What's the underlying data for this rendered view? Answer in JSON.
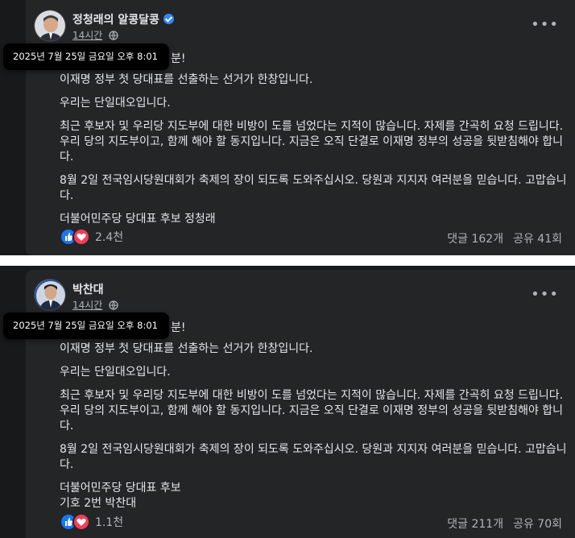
{
  "posts": [
    {
      "author": "정청래의 알콩달콩",
      "verified": true,
      "time": "14시간",
      "tooltip": "2025년 7월 25일 금요일 오후 8:01",
      "first_line_trail": "분!",
      "paragraphs": [
        "이재명 정부 첫 당대표를 선출하는 선거가 한창입니다.",
        "우리는 단일대오입니다.",
        "최근 후보자 및 우리당 지도부에 대한 비방이 도를 넘었다는 지적이 많습니다. 자제를 간곡히 요청 드립니다. 우리 당의 지도부이고, 함께 해야 할 동지입니다. 지금은 오직 단결로 이재명 정부의 성공을 뒷받침해야 합니다.",
        "8월 2일 전국임시당원대회가 축제의 장이 되도록 도와주십시오. 당원과 지지자 여러분을 믿습니다. 고맙습니다.",
        "더불어민주당 당대표 후보 정청래"
      ],
      "reaction_count": "2.4천",
      "comments": "댓글 162개",
      "shares": "공유 41회"
    },
    {
      "author": "박찬대",
      "verified": false,
      "time": "14시간",
      "tooltip": "2025년 7월 25일 금요일 오후 8:01",
      "first_line_trail": "분!",
      "paragraphs": [
        "이재명 정부 첫 당대표를 선출하는 선거가 한창입니다.",
        "우리는 단일대오입니다.",
        "최근 후보자 및 우리당 지도부에 대한 비방이 도를 넘었다는 지적이 많습니다. 자제를 간곡히 요청 드립니다. 우리 당의 지도부이고, 함께 해야 할 동지입니다. 지금은 오직 단결로 이재명 정부의 성공을 뒷받침해야 합니다.",
        "8월 2일 전국임시당원대회가 축제의 장이 되도록 도와주십시오. 당원과 지지자 여러분을 믿습니다. 고맙습니다.",
        "더불어민주당 당대표 후보",
        "기호 2번 박찬대"
      ],
      "reaction_count": "1.1천",
      "comments": "댓글 211개",
      "shares": "공유 70회"
    }
  ],
  "icons": {
    "globe": "globe-icon",
    "more": "more-options-icon",
    "like": "like-reaction-icon",
    "love": "love-reaction-icon",
    "verified": "verified-badge-icon"
  },
  "colors": {
    "background": "#18191a",
    "card": "#242526",
    "text": "#e4e6eb",
    "secondary_text": "#b0b3b8",
    "like": "#1877f2",
    "love": "#f33e58",
    "verified": "#2d88ff"
  }
}
